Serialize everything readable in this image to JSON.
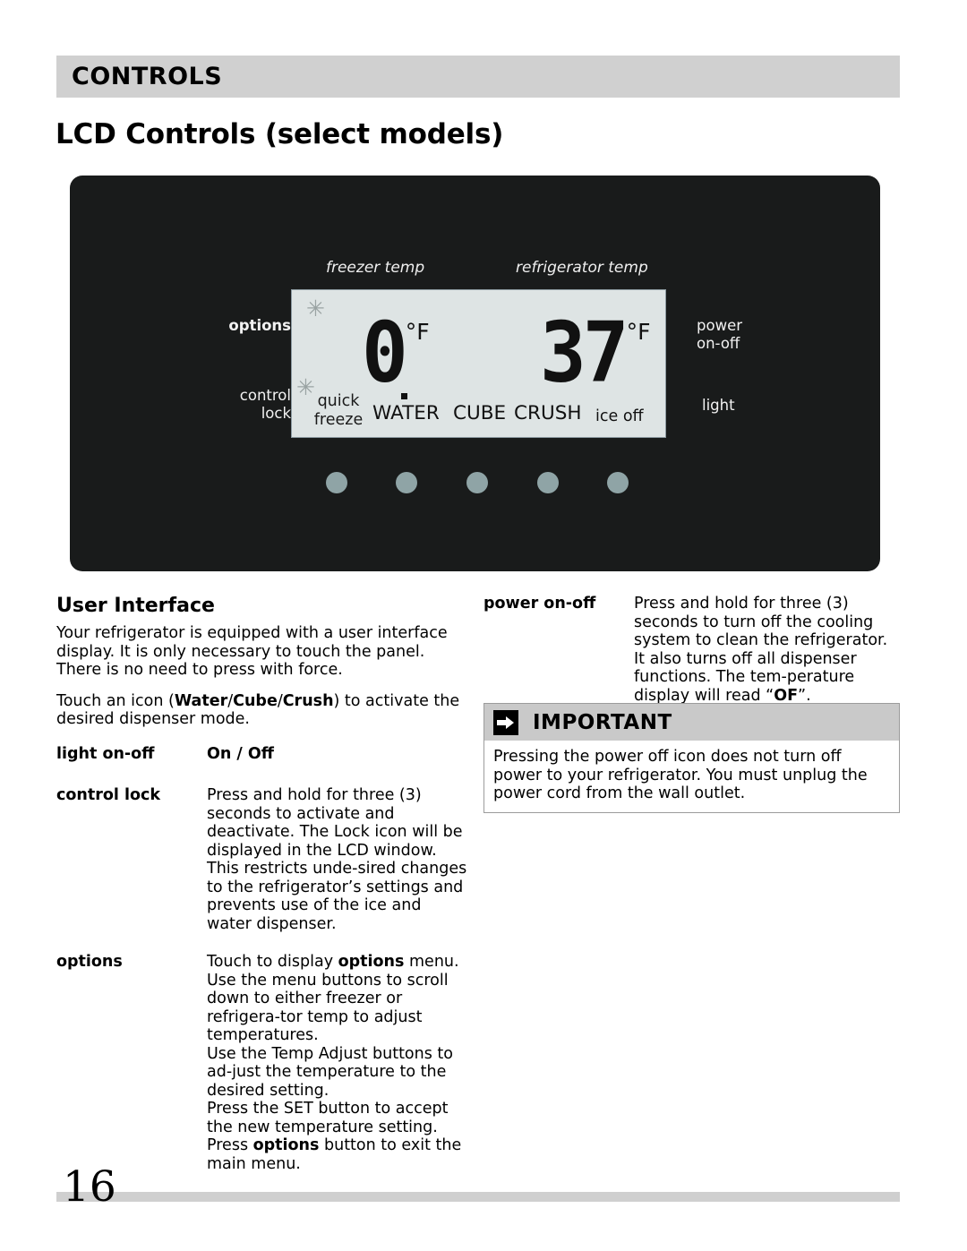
{
  "header": {
    "section_title": "CONTROLS",
    "page_title": "LCD Controls (select models)"
  },
  "panel": {
    "freezer_caption": "freezer temp",
    "refrigerator_caption": "refrigerator temp",
    "left_labels": {
      "options": "options",
      "control_lock_line1": "control",
      "control_lock_line2": "lock"
    },
    "right_labels": {
      "power_line1": "power",
      "power_line2": "on-off",
      "light": "light"
    },
    "lcd": {
      "freezer_value": "0",
      "freezer_unit": "°F",
      "refrigerator_value": "37",
      "refrigerator_unit": "°F",
      "quick_freeze_line1": "quick",
      "quick_freeze_line2": "freeze",
      "mode_water": "WATER",
      "mode_cube": "CUBE",
      "mode_crush": "CRUSH",
      "mode_ice_off": "ice off",
      "snowflake_glyph": "✳",
      "screen_color": "#dee4e4",
      "segment_color": "#111111",
      "snowflake_color": "#9aa3a3"
    },
    "button_count": 5,
    "button_color": "#8fa4a6",
    "body_color": "#191b1b"
  },
  "left_column": {
    "heading": "User Interface",
    "paragraph1": "Your refrigerator is equipped with a user interface display. It is only necessary to touch the panel.  There is no need to press with force.",
    "paragraph2_pre": "Touch an icon (",
    "paragraph2_bold1": "Water",
    "paragraph2_sep1": "/",
    "paragraph2_bold2": "Cube",
    "paragraph2_sep2": "/",
    "paragraph2_bold3": "Crush",
    "paragraph2_post": ") to activate the desired dispenser mode.",
    "rows": [
      {
        "term": "light on-off",
        "desc_bold": "On / Off"
      },
      {
        "term": "control lock",
        "desc": "Press and hold for three (3) seconds to activate and deactivate.  The Lock icon will be displayed in the LCD window.  This restricts unde-sired changes to the refrigerator’s settings and prevents use of the ice and water dispenser."
      },
      {
        "term": "options",
        "p1_pre": "Touch to display ",
        "p1_bold": "options",
        "p1_post": " menu.",
        "p2": "Use the menu buttons to scroll down to either freezer or refrigera-tor temp to adjust temperatures.",
        "p3": "Use the Temp Adjust buttons to ad-just the temperature to the desired setting.",
        "p4": "Press the SET button to accept the new temperature setting.",
        "p5_pre": "Press ",
        "p5_bold": "options",
        "p5_post": " button to exit the main menu."
      }
    ]
  },
  "right_column": {
    "power_term": "power on-off",
    "power_desc_pre": "Press and hold for three (3) seconds to turn off the cooling system to clean the refrigerator.  It also turns off all dispenser functions. The tem-perature display will read “",
    "power_desc_bold": "OF",
    "power_desc_post": "”."
  },
  "important_box": {
    "icon": "arrow-right-icon",
    "title": "IMPORTANT",
    "body": "Pressing the power off icon does not turn off power to your refrigerator. You must unplug the power cord from the wall outlet.",
    "header_color": "#c9c9c9"
  },
  "footer": {
    "page_number": "16",
    "bar_color": "#cfcfcf"
  }
}
